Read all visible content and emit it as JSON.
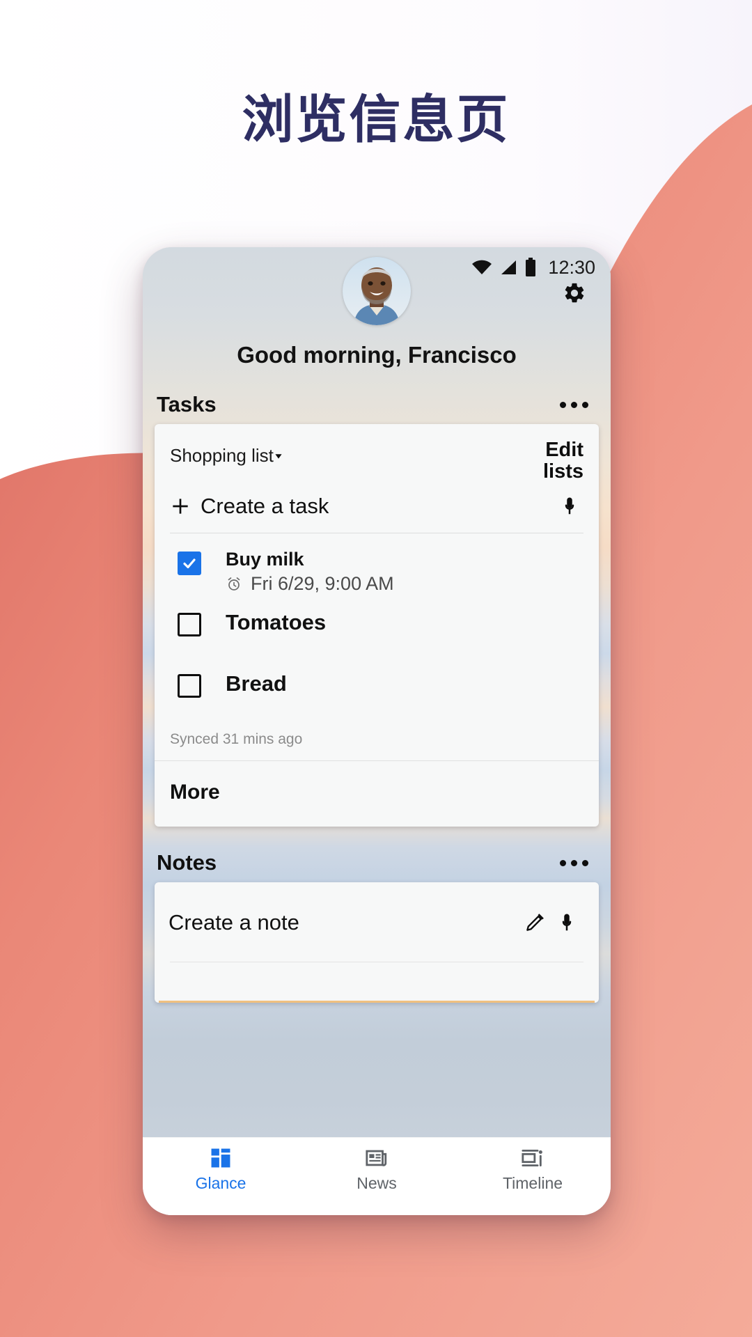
{
  "page": {
    "title": "浏览信息页",
    "title_color": "#2e2e63",
    "accent_color": "#1a73e8",
    "background_color": "#ef8d7e"
  },
  "phone": {
    "status_bar": {
      "time": "12:30",
      "icons": [
        "wifi-icon",
        "signal-icon",
        "battery-icon"
      ]
    },
    "header": {
      "avatar_name": "avatar",
      "settings_icon": "gear-icon",
      "greeting": "Good morning, Francisco"
    },
    "tasks_section": {
      "title": "Tasks",
      "overflow_icon": "overflow-menu-icon",
      "list_name": "Shopping list",
      "list_caret_icon": "chevron-down-icon",
      "edit_lists_label": "Edit lists",
      "create_task_label": "Create a task",
      "create_task_plus_icon": "plus-icon",
      "mic_icon": "microphone-icon",
      "items": [
        {
          "label": "Buy milk",
          "checked": true,
          "reminder_icon": "alarm-clock-icon",
          "reminder": "Fri 6/29, 9:00 AM"
        },
        {
          "label": "Tomatoes",
          "checked": false,
          "reminder": ""
        },
        {
          "label": "Bread",
          "checked": false,
          "reminder": ""
        }
      ],
      "synced_status": "Synced 31 mins ago",
      "more_label": "More"
    },
    "notes_section": {
      "title": "Notes",
      "overflow_icon": "overflow-menu-icon",
      "create_note_label": "Create a note",
      "pencil_icon": "pencil-icon",
      "mic_icon": "microphone-icon"
    },
    "bottom_nav": {
      "items": [
        {
          "label": "Glance",
          "icon": "dashboard-icon",
          "active": true
        },
        {
          "label": "News",
          "icon": "newspaper-icon",
          "active": false
        },
        {
          "label": "Timeline",
          "icon": "timeline-icon",
          "active": false
        }
      ]
    }
  }
}
